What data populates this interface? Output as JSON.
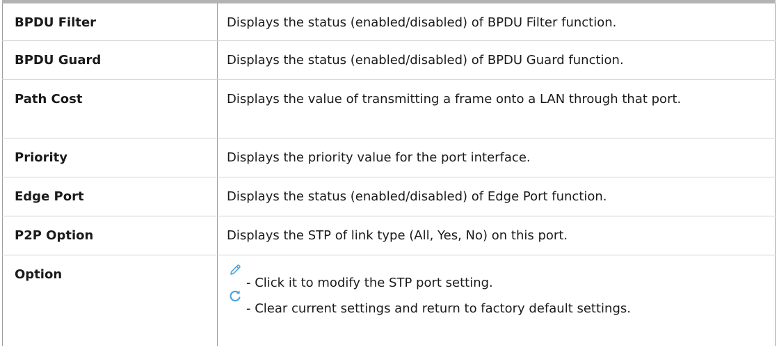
{
  "rows": [
    {
      "term": "BPDU Filter",
      "definition": "Displays the status (enabled/disabled) of BPDU Filter function."
    },
    {
      "term": "BPDU Guard",
      "definition": "Displays the status (enabled/disabled) of BPDU Guard function."
    },
    {
      "term": "Path Cost",
      "definition": "Displays the value of transmitting a frame onto a LAN through that port."
    },
    {
      "term": "Priority",
      "definition": "Displays the priority value for the port interface."
    },
    {
      "term": "Edge Port",
      "definition": "Displays the status (enabled/disabled) of Edge Port function."
    },
    {
      "term": "P2P Option",
      "definition": "Displays the STP of link type (All, Yes, No) on this port."
    }
  ],
  "option": {
    "term": "Option",
    "edit_text": "- Click it to modify the STP port setting.",
    "reset_text": "- Clear current settings and return to factory default settings.",
    "edit_icon": "pencil-icon",
    "reset_icon": "refresh-icon",
    "icon_color": "#4aa3df"
  }
}
